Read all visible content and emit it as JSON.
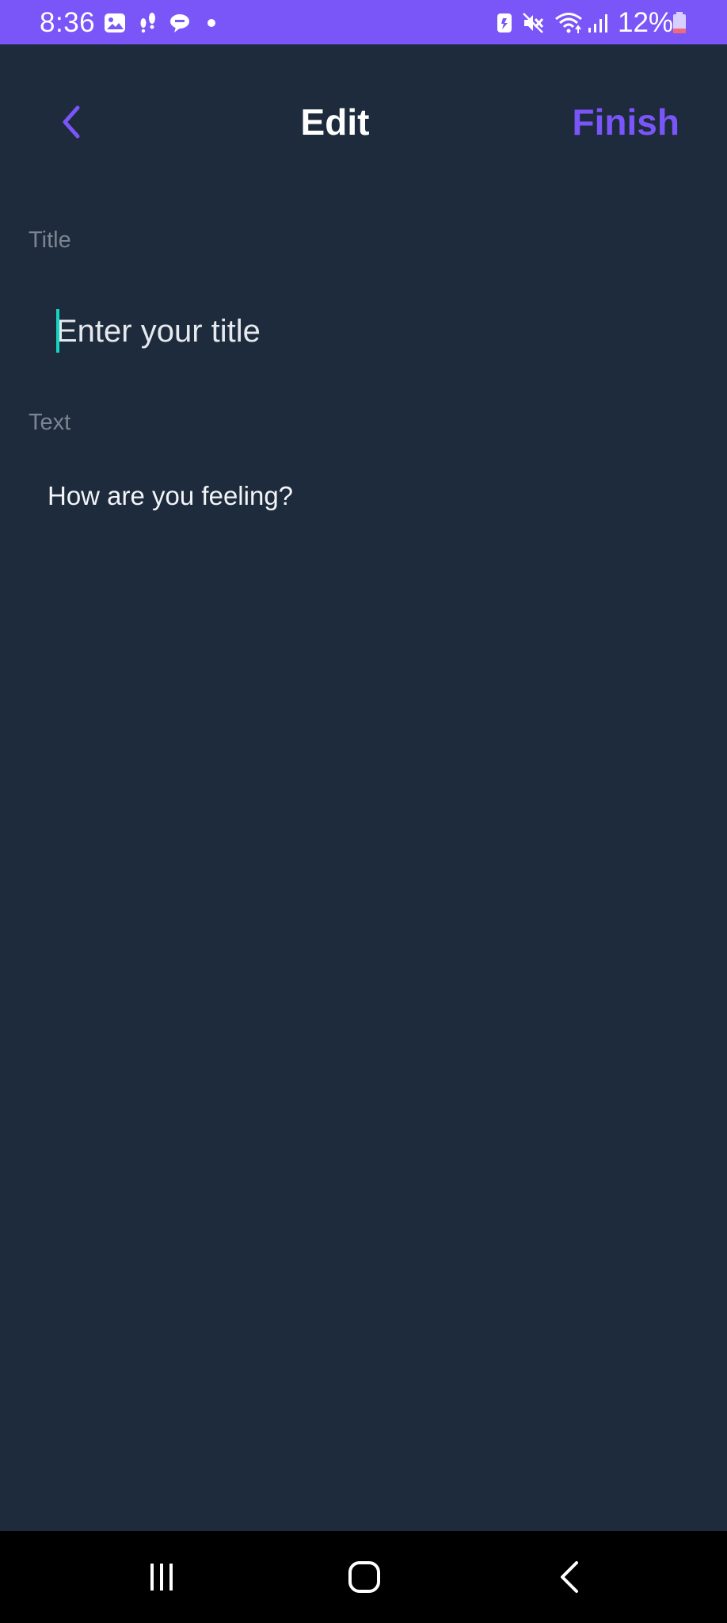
{
  "status_bar": {
    "time": "8:36",
    "battery_percent": "12%",
    "background_color": "#7a55f8",
    "left_icons": [
      "gallery-icon",
      "footsteps-icon",
      "chat-bubble-icon",
      "notification-dot-icon"
    ],
    "right_icons": [
      "battery-saver-icon",
      "mute-icon",
      "wifi-icon",
      "signal-icon",
      "battery-icon"
    ]
  },
  "header": {
    "back_icon": "chevron-left-icon",
    "title": "Edit",
    "finish_label": "Finish",
    "accent_color": "#7a55f8"
  },
  "form": {
    "title_label": "Title",
    "title_placeholder": "Enter your title",
    "title_value": "",
    "text_label": "Text",
    "text_placeholder": "How are you feeling?",
    "text_value": "",
    "caret_color": "#15d3c1"
  },
  "nav_bar": {
    "recents_icon": "recents-icon",
    "home_icon": "home-icon",
    "back_icon": "back-icon"
  },
  "colors": {
    "background": "#1d2b3c",
    "label": "#7b8592"
  }
}
